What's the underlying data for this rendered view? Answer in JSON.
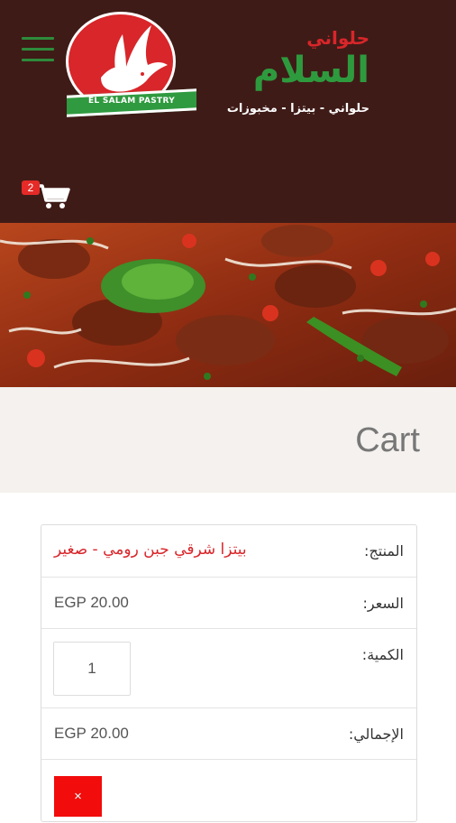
{
  "header": {
    "menu_icon": "hamburger-menu-icon",
    "logo_ribbon_text": "EL SALAM PASTRY",
    "brand_small": "حلواني",
    "brand_large": "السلام",
    "brand_tagline": "حلواني - بيتزا - مخبوزات",
    "cart_icon": "shopping-cart-icon",
    "cart_count": "2"
  },
  "page": {
    "title": "Cart"
  },
  "cart": {
    "product_label": "المنتج:",
    "product_name": "بيتزا شرقي جبن رومي - صغير",
    "price_label": "السعر:",
    "price_value": "EGP 20.00",
    "quantity_label": "الكمية:",
    "quantity_value": "1",
    "total_label": "الإجمالي:",
    "total_value": "EGP 20.00",
    "remove_label": "×"
  },
  "colors": {
    "header_bg": "#3f1b17",
    "brand_red": "#d8262a",
    "brand_green": "#2e9a3e",
    "remove_red": "#f20c0c"
  }
}
